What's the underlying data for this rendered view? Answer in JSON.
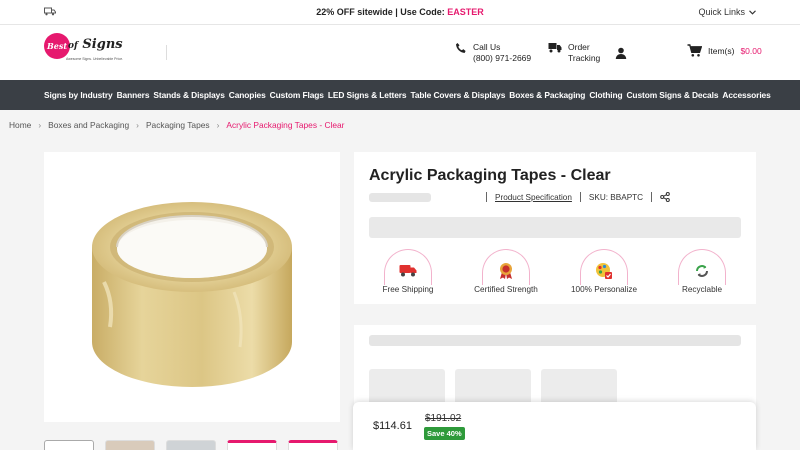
{
  "promo": {
    "offer": "22% OFF sitewide | Use Code: ",
    "code": "EASTER",
    "quick_links": "Quick Links"
  },
  "header": {
    "logo": {
      "mark": "Best",
      "of": "of",
      "name": "Signs",
      "tagline": "Awesome Signs. Unbelievable Price."
    },
    "call_label": "Call Us",
    "call_number": "(800) 971-2669",
    "order_line1": "Order",
    "order_line2": "Tracking",
    "cart_items": "Item(s)",
    "cart_amount": "$0.00"
  },
  "nav": {
    "items": [
      "Signs by Industry",
      "Banners",
      "Stands & Displays",
      "Canopies",
      "Custom Flags",
      "LED Signs & Letters",
      "Table Covers & Displays",
      "Boxes & Packaging",
      "Clothing",
      "Custom Signs & Decals",
      "Accessories"
    ]
  },
  "breadcrumb": [
    "Home",
    "Boxes and Packaging",
    "Packaging Tapes",
    "Acrylic Packaging Tapes - Clear"
  ],
  "product": {
    "title": "Acrylic Packaging Tapes - Clear",
    "spec_link": "Product Specification",
    "sku": "SKU: BBAPTC",
    "features": [
      "Free Shipping",
      "Certified Strength",
      "100% Personalize",
      "Recyclable"
    ]
  },
  "pricing": {
    "price": "$114.61",
    "original": "$191.02",
    "save": "Save 40%"
  },
  "colors": {
    "accent": "#e6196e",
    "nav_bg": "#3a3f45",
    "save_green": "#2e9a3a"
  }
}
